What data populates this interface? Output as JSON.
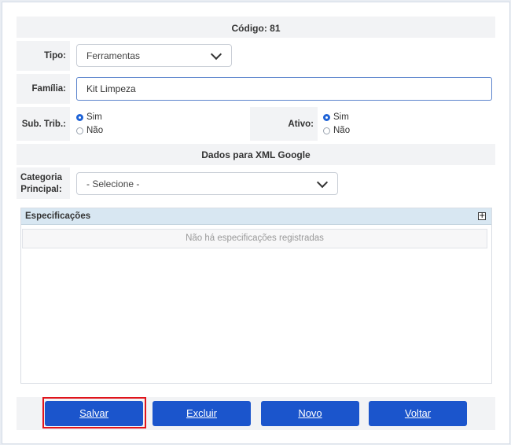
{
  "header": {
    "codigo": "Código: 81"
  },
  "form": {
    "tipo": {
      "label": "Tipo:",
      "value": "Ferramentas"
    },
    "familia": {
      "label": "Família:",
      "value": "Kit Limpeza"
    },
    "sub_trib": {
      "label": "Sub. Trib.:",
      "options": [
        "Sim",
        "Não"
      ],
      "selected": "Sim"
    },
    "ativo": {
      "label": "Ativo:",
      "options": [
        "Sim",
        "Não"
      ],
      "selected": "Sim"
    }
  },
  "xml_section": {
    "title": "Dados para XML Google",
    "categoria": {
      "label_line1": "Categoria",
      "label_line2": "Principal:",
      "value": "- Selecione -"
    }
  },
  "specs": {
    "title": "Especificações",
    "add_icon": "plus-square-icon",
    "empty_text": "Não há especificações registradas"
  },
  "buttons": {
    "salvar": "Salvar",
    "excluir": "Excluir",
    "novo": "Novo",
    "voltar": "Voltar"
  },
  "colors": {
    "button_bg": "#1b55cc",
    "highlight": "#e0141b",
    "radio_on": "#1f63d6"
  }
}
